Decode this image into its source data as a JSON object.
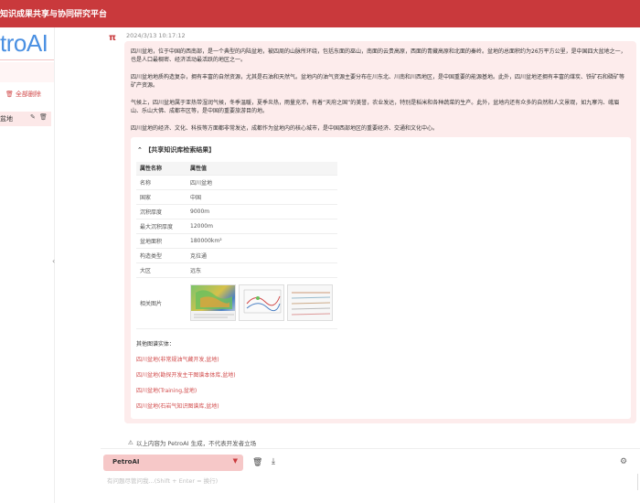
{
  "app": {
    "title": "知识成果共享与协同研究平台",
    "logo": "troAI"
  },
  "sidebar": {
    "delete_label": "全部删除",
    "conversation_label": "盆地"
  },
  "message": {
    "timestamp": "2024/3/13 10:17:12",
    "paragraphs": [
      "四川盆地，位于中国的西南部，是一个典型的内陆盆地，被四周的山脉所环绕，包括东面的巫山，南面的云贵高原，西面的青藏高原和北面的秦岭。盆地的总面积约为26万平方公里，是中国四大盆地之一，也是人口最稠密、经济活动最活跃的地区之一。",
      "四川盆地地质构造复杂，拥有丰富的自然资源，尤其是石油和天然气。盆地内的油气资源主要分布在川东北、川南和川西地区，是中国重要的能源基地。此外，四川盆地还拥有丰富的煤炭、铁矿石和磷矿等矿产资源。",
      "气候上，四川盆地属于亚热带湿润气候，冬季温暖，夏季炎热，雨量充沛，有着“天府之国”的美誉，农业发达，特别是稻米和各种蔬菜的生产。此外，盆地内还有众多的自然和人文景观，如九寨沟、峨眉山、乐山大佛、成都市区等，是中国的重要旅游目的地。",
      "四川盆地的经济、文化、科技等方面都非常发达，成都作为盆地内的核心城市，是中国西部地区的重要经济、交通和文化中心。"
    ]
  },
  "knowledge": {
    "header": "【共享知识库检索结果】",
    "table_headers": [
      "属性名称",
      "属性值"
    ],
    "rows": [
      {
        "k": "名称",
        "v": "四川盆地"
      },
      {
        "k": "国家",
        "v": "中国"
      },
      {
        "k": "沉积厚度",
        "v": "9000m"
      },
      {
        "k": "最大沉积厚度",
        "v": "12000m"
      },
      {
        "k": "盆地面积",
        "v": "180000km²"
      },
      {
        "k": "构造类型",
        "v": "克拉通"
      },
      {
        "k": "大区",
        "v": "远东"
      },
      {
        "k": "相关图片",
        "v": ""
      }
    ],
    "other_title": "其他图谱实体：",
    "links": [
      "四川盆地(非常规油气藏开发,盆地)",
      "四川盆地(勘探开发主干图谱本体库,盆地)",
      "四川盆地(Training,盆地)",
      "四川盆地(石岩气知识图谱库,盆地)"
    ]
  },
  "disclaimer": "以上内容为 PetroAI 生成，不代表开发者立场",
  "input": {
    "model": "PetroAI",
    "placeholder": "有问题尽管问我...(Shift + Enter = 换行)"
  },
  "colors": {
    "brand": "#c9393c",
    "bubble": "#fdecec",
    "link": "#d14a4a"
  }
}
